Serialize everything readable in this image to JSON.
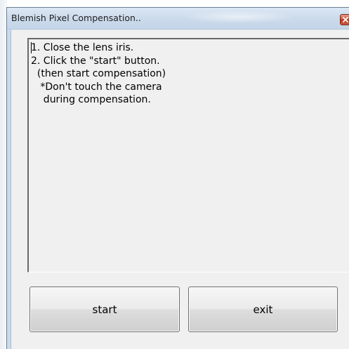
{
  "window": {
    "title": "Blemish Pixel Compensation.."
  },
  "message": {
    "text": "1. Close the lens iris.\n2. Click the \"start\" button.\n  (then start compensation)\n   *Don't touch the camera\n    during compensation."
  },
  "buttons": {
    "start_label": "start",
    "exit_label": "exit"
  },
  "icons": {
    "close": "close-icon"
  },
  "colors": {
    "titlebar": "#c9dbec",
    "client_background": "#f0f0f0",
    "close_button": "#c8472c"
  }
}
